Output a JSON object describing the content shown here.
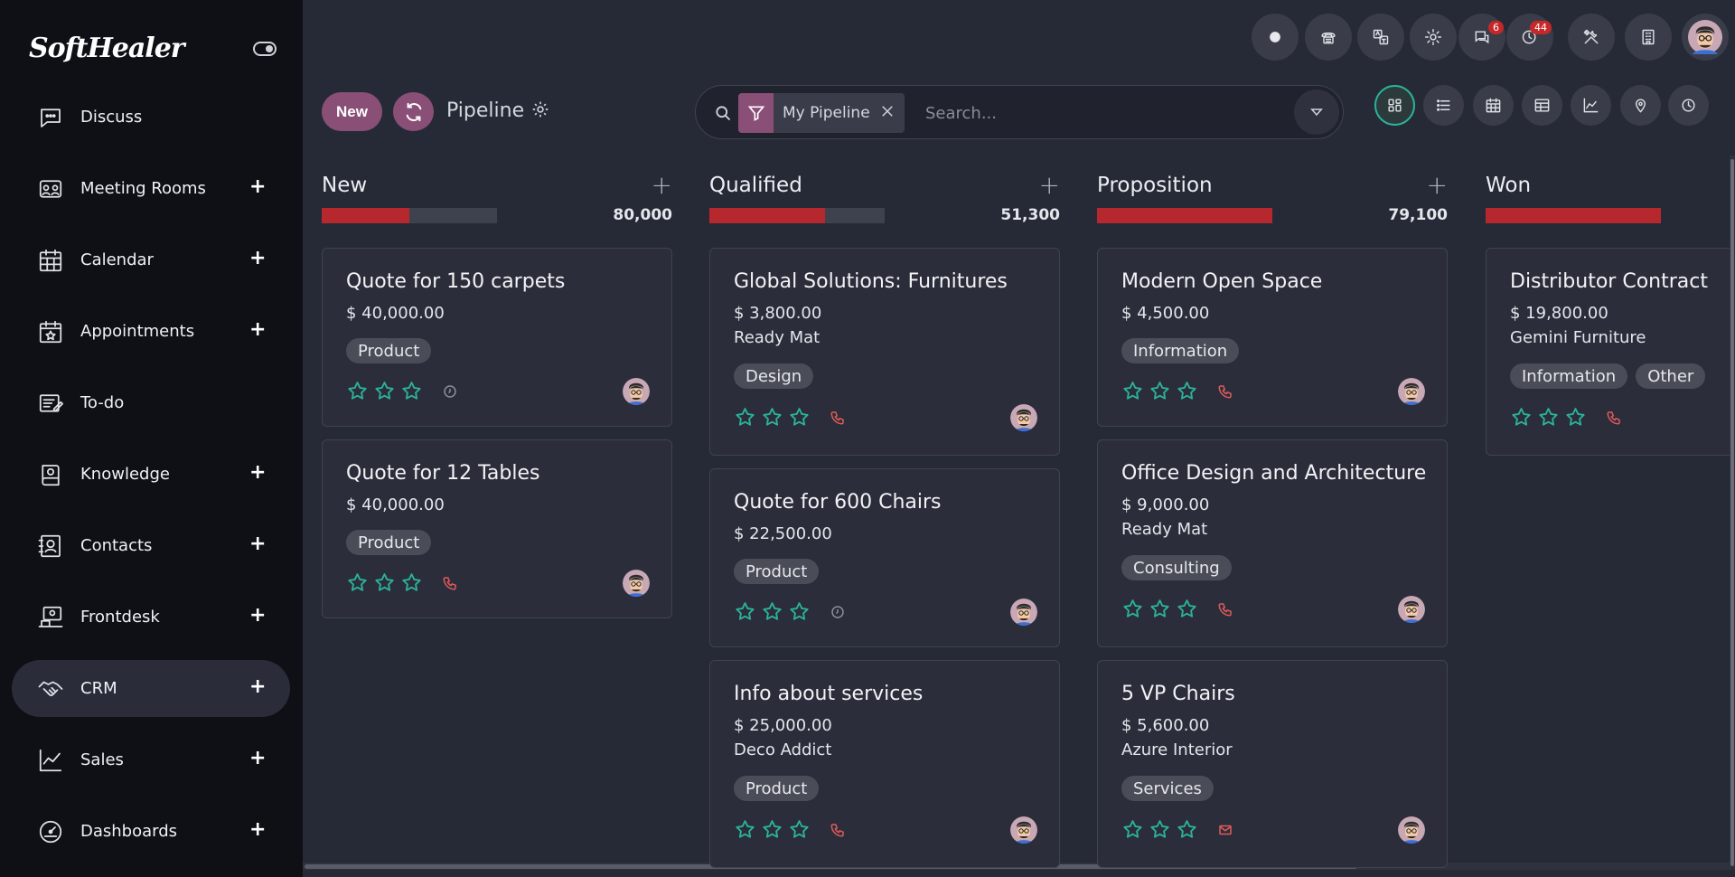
{
  "app": {
    "logo": "SoftHealer"
  },
  "sidebar": {
    "items": [
      {
        "label": "Discuss",
        "icon": "chat-bubble-icon",
        "plus": false,
        "active": false
      },
      {
        "label": "Meeting Rooms",
        "icon": "meeting-room-icon",
        "plus": true,
        "active": false
      },
      {
        "label": "Calendar",
        "icon": "calendar-icon",
        "plus": true,
        "active": false
      },
      {
        "label": "Appointments",
        "icon": "appointment-calendar-icon",
        "plus": true,
        "active": false
      },
      {
        "label": "To-do",
        "icon": "todo-icon",
        "plus": false,
        "active": false
      },
      {
        "label": "Knowledge",
        "icon": "knowledge-book-icon",
        "plus": true,
        "active": false
      },
      {
        "label": "Contacts",
        "icon": "contact-card-icon",
        "plus": true,
        "active": false
      },
      {
        "label": "Frontdesk",
        "icon": "frontdesk-icon",
        "plus": true,
        "active": false
      },
      {
        "label": "CRM",
        "icon": "handshake-icon",
        "plus": true,
        "active": true
      },
      {
        "label": "Sales",
        "icon": "sales-chart-icon",
        "plus": true,
        "active": false
      },
      {
        "label": "Dashboards",
        "icon": "dashboard-gauge-icon",
        "plus": true,
        "active": false
      }
    ],
    "plus_label": "+"
  },
  "topbar": {
    "buttons": [
      {
        "icon": "status-dot-icon"
      },
      {
        "icon": "phone-icon"
      },
      {
        "icon": "translate-icon"
      },
      {
        "icon": "settings-gear-icon"
      },
      {
        "icon": "messages-icon",
        "badge": "6"
      },
      {
        "icon": "activity-clock-icon",
        "badge": "44"
      },
      {
        "icon": "tools-icon"
      },
      {
        "icon": "company-building-icon"
      },
      {
        "icon": "user-avatar-icon"
      }
    ]
  },
  "control": {
    "new_label": "New",
    "breadcrumb": "Pipeline",
    "filter_label": "My Pipeline",
    "search_placeholder": "Search..."
  },
  "views": [
    "kanban-view-icon",
    "list-view-icon",
    "calendar-view-icon",
    "pivot-view-icon",
    "graph-view-icon",
    "map-view-icon",
    "activity-view-icon"
  ],
  "columns": [
    {
      "title": "New",
      "total": "80,000",
      "progress": 0.5,
      "plus": "+",
      "cards": [
        {
          "title": "Quote for 150 carpets",
          "amount": "$ 40,000.00",
          "company": "",
          "tags": [
            "Product"
          ],
          "activity": "clock"
        },
        {
          "title": "Quote for 12 Tables",
          "amount": "$ 40,000.00",
          "company": "",
          "tags": [
            "Product"
          ],
          "activity": "phone"
        }
      ]
    },
    {
      "title": "Qualified",
      "total": "51,300",
      "progress": 0.66,
      "plus": "+",
      "cards": [
        {
          "title": "Global Solutions: Furnitures",
          "amount": "$ 3,800.00",
          "company": "Ready Mat",
          "tags": [
            "Design"
          ],
          "activity": "phone"
        },
        {
          "title": "Quote for 600 Chairs",
          "amount": "$ 22,500.00",
          "company": "",
          "tags": [
            "Product"
          ],
          "activity": "clock"
        },
        {
          "title": "Info about services",
          "amount": "$ 25,000.00",
          "company": "Deco Addict",
          "tags": [
            "Product"
          ],
          "activity": "phone"
        }
      ]
    },
    {
      "title": "Proposition",
      "total": "79,100",
      "progress": 1.0,
      "plus": "+",
      "cards": [
        {
          "title": "Modern Open Space",
          "amount": "$ 4,500.00",
          "company": "",
          "tags": [
            "Information"
          ],
          "activity": "phone"
        },
        {
          "title": "Office Design and Architecture",
          "amount": "$ 9,000.00",
          "company": "Ready Mat",
          "tags": [
            "Consulting"
          ],
          "activity": "phone"
        },
        {
          "title": "5 VP Chairs",
          "amount": "$ 5,600.00",
          "company": "Azure Interior",
          "tags": [
            "Services"
          ],
          "activity": "email"
        }
      ]
    },
    {
      "title": "Won",
      "total": "",
      "progress": 1.0,
      "plus": "",
      "cards": [
        {
          "title": "Distributor Contract",
          "amount": "$ 19,800.00",
          "company": "Gemini Furniture",
          "tags": [
            "Information",
            "Other"
          ],
          "activity": "phone"
        }
      ]
    }
  ],
  "colors": {
    "accent": "#8a4f77",
    "progress_fill": "#b7282e",
    "star": "#2bb39a",
    "phone": "#e05a5a"
  }
}
